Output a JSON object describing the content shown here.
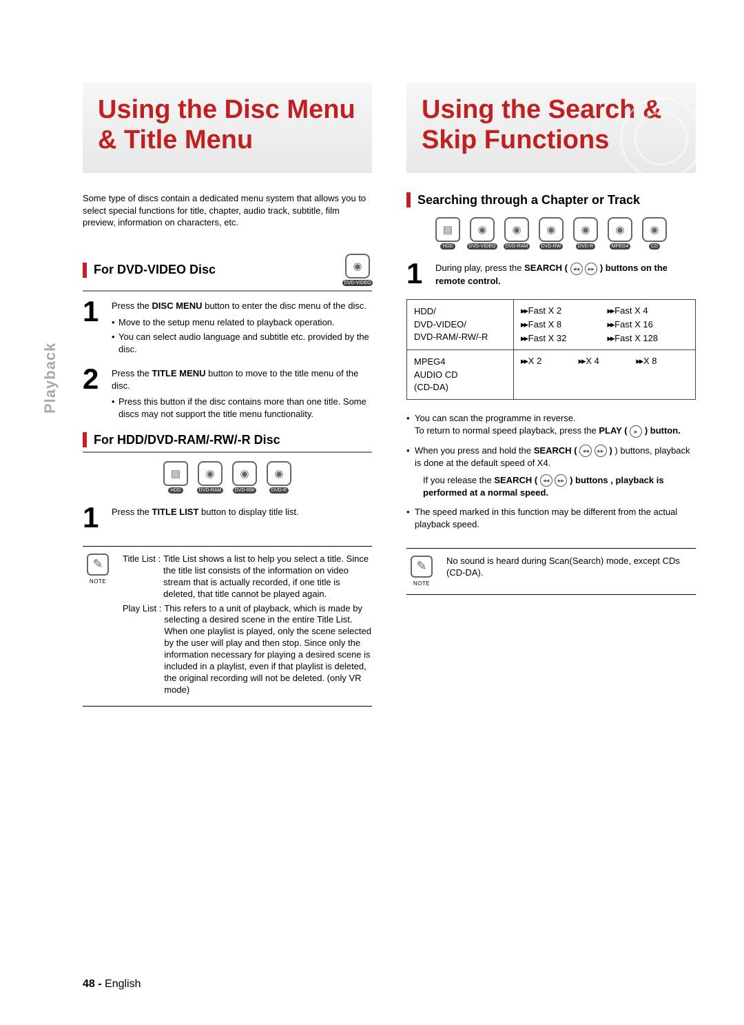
{
  "tab_label": "Playback",
  "page_number": "48 -",
  "page_lang": "English",
  "media_labels": {
    "hdd": "HDD",
    "dvd_video": "DVD-VIDEO",
    "dvd_ram": "DVD-RAM",
    "dvd_rw": "DVD-RW",
    "dvd_r": "DVD-R",
    "mpeg4": "MPEG4",
    "cd": "CD"
  },
  "left": {
    "hero": "Using the Disc Menu & Title Menu",
    "intro": "Some type of discs contain a dedicated menu system that allows you to select special functions for title, chapter, audio track, subtitle, film preview, information on characters, etc.",
    "sec1": {
      "heading": "For DVD-VIDEO Disc",
      "step1": {
        "num": "1",
        "text_pre": "Press the ",
        "text_bold": "DISC MENU",
        "text_post": " button to enter the disc menu of the disc.",
        "b1": "Move to the setup menu related to playback operation.",
        "b2": "You can select audio language and subtitle etc. provided by the disc."
      },
      "step2": {
        "num": "2",
        "text_pre": "Press the ",
        "text_bold": "TITLE MENU",
        "text_post": " button to move to the title menu of the disc.",
        "b1": "Press this button if the disc contains more than one title. Some discs may not support the title menu functionality."
      }
    },
    "sec2": {
      "heading": "For HDD/DVD-RAM/-RW/-R Disc",
      "step1": {
        "num": "1",
        "text_pre": "Press the ",
        "text_bold": "TITLE LIST",
        "text_post": " button to display title list."
      }
    },
    "note": {
      "label": "NOTE",
      "title_list_label": "Title List :",
      "title_list_text": "Title List shows a list to help you select a title. Since the title list consists of the information on video stream that is actually recorded, if one title is deleted, that title cannot be played again.",
      "play_list_label": "Play List :",
      "play_list_text": "This refers to a unit of playback, which is made by selecting a desired scene in the entire Title List. When one playlist is played, only the scene selected by the user will play and then stop. Since only the information necessary for playing a desired scene is included in a playlist, even if that playlist is deleted, the original recording will not be deleted. (only VR mode)"
    }
  },
  "right": {
    "hero": "Using the Search & Skip Functions",
    "sec1": {
      "heading": "Searching through a Chapter or Track",
      "step1": {
        "num": "1",
        "text_pre": "During play, press the ",
        "text_bold": "SEARCH (",
        "text_post": " ) buttons on the remote control."
      },
      "table": {
        "row1_left": "HDD/\nDVD-VIDEO/\nDVD-RAM/-RW/-R",
        "row1_speeds": [
          "Fast X 2",
          "Fast X 4",
          "Fast X 8",
          "Fast X 16",
          "Fast X 32",
          "Fast X 128"
        ],
        "row2_left": "MPEG4\nAUDIO CD\n(CD-DA)",
        "row2_speeds": [
          "X 2",
          "X 4",
          "X 8"
        ]
      },
      "bullets": {
        "b1a": "You can scan the programme in reverse.",
        "b1b_pre": "To return to normal speed playback, press the ",
        "b1b_bold": "PLAY (",
        "b1b_post": " ) button.",
        "b2_pre": "When you press and hold the ",
        "b2_bold": "SEARCH (",
        "b2_mid": " ) buttons, playback is done at the default speed of X4.",
        "b2_sub_pre": "If you release the ",
        "b2_sub_bold": "SEARCH (",
        "b2_sub_post": " ) buttons , playback is performed at a normal speed.",
        "b3": "The speed marked in this function may be different from the actual playback speed."
      }
    },
    "note": {
      "label": "NOTE",
      "text": "No sound is heard during Scan(Search) mode, except CDs (CD-DA)."
    }
  }
}
